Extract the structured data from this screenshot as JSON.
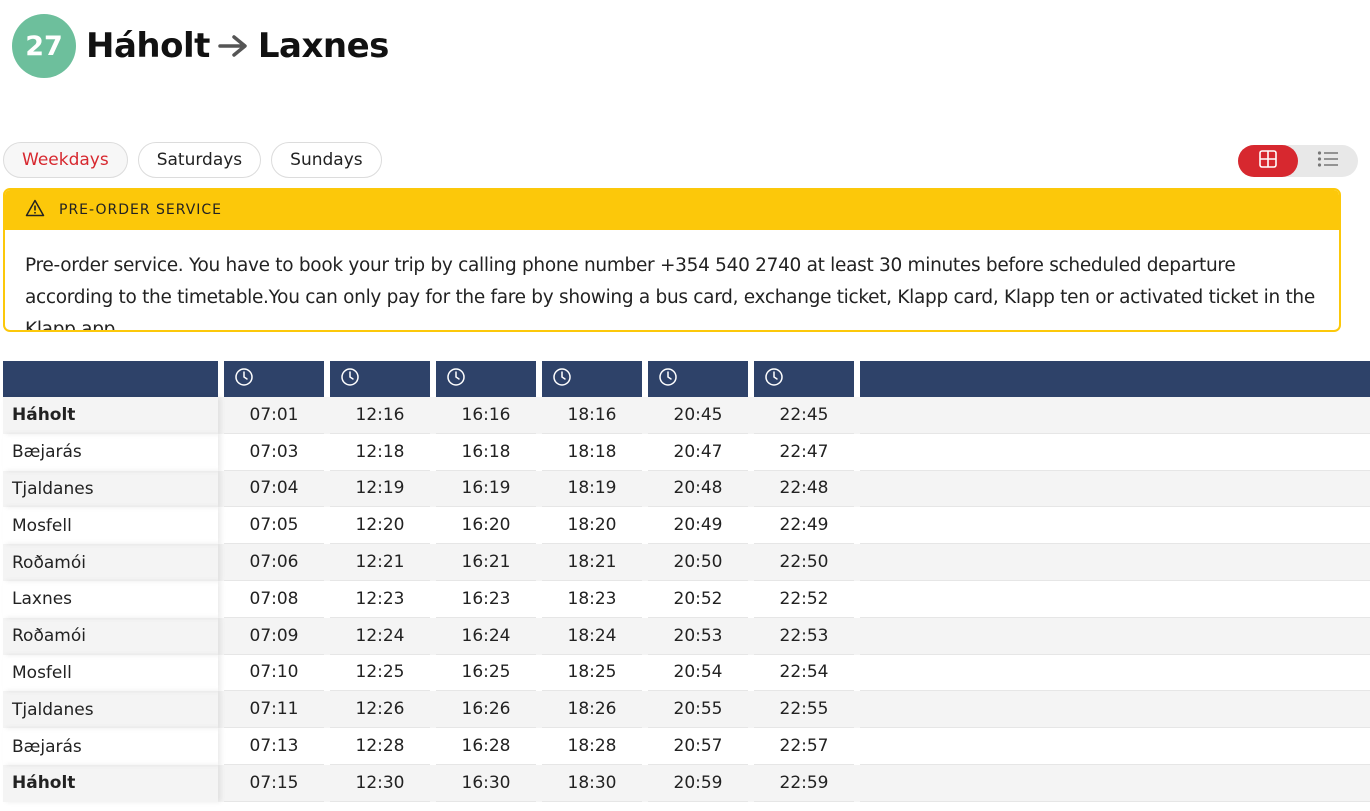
{
  "route": {
    "number": "27",
    "from": "Háholt",
    "to": "Laxnes"
  },
  "tabs": [
    "Weekdays",
    "Saturdays",
    "Sundays"
  ],
  "active_tab": "Weekdays",
  "view_toggle": {
    "active": "grid",
    "icons": [
      "grid-icon",
      "list-icon"
    ]
  },
  "notice": {
    "title": "PRE-ORDER SERVICE",
    "body": "Pre-order service. You have to book your trip by calling phone number +354 540 2740 at least 30 minutes before scheduled departure according to the timetable.You can only pay for the fare by showing a bus card, exchange ticket, Klapp card, Klapp ten or activated ticket in the Klapp app."
  },
  "timetable": {
    "rows": [
      {
        "stop": "Háholt",
        "bold": true,
        "times": [
          "07:01",
          "12:16",
          "16:16",
          "18:16",
          "20:45",
          "22:45"
        ]
      },
      {
        "stop": "Bæjarás",
        "bold": false,
        "times": [
          "07:03",
          "12:18",
          "16:18",
          "18:18",
          "20:47",
          "22:47"
        ]
      },
      {
        "stop": "Tjaldanes",
        "bold": false,
        "times": [
          "07:04",
          "12:19",
          "16:19",
          "18:19",
          "20:48",
          "22:48"
        ]
      },
      {
        "stop": "Mosfell",
        "bold": false,
        "times": [
          "07:05",
          "12:20",
          "16:20",
          "18:20",
          "20:49",
          "22:49"
        ]
      },
      {
        "stop": "Roðamói",
        "bold": false,
        "times": [
          "07:06",
          "12:21",
          "16:21",
          "18:21",
          "20:50",
          "22:50"
        ]
      },
      {
        "stop": "Laxnes",
        "bold": false,
        "times": [
          "07:08",
          "12:23",
          "16:23",
          "18:23",
          "20:52",
          "22:52"
        ]
      },
      {
        "stop": "Roðamói",
        "bold": false,
        "times": [
          "07:09",
          "12:24",
          "16:24",
          "18:24",
          "20:53",
          "22:53"
        ]
      },
      {
        "stop": "Mosfell",
        "bold": false,
        "times": [
          "07:10",
          "12:25",
          "16:25",
          "18:25",
          "20:54",
          "22:54"
        ]
      },
      {
        "stop": "Tjaldanes",
        "bold": false,
        "times": [
          "07:11",
          "12:26",
          "16:26",
          "18:26",
          "20:55",
          "22:55"
        ]
      },
      {
        "stop": "Bæjarás",
        "bold": false,
        "times": [
          "07:13",
          "12:28",
          "16:28",
          "18:28",
          "20:57",
          "22:57"
        ]
      },
      {
        "stop": "Háholt",
        "bold": true,
        "times": [
          "07:15",
          "12:30",
          "16:30",
          "18:30",
          "20:59",
          "22:59"
        ]
      }
    ]
  },
  "colors": {
    "route_badge": "#6dbf9c",
    "accent_red": "#d7282f",
    "notice_yellow": "#fcc80a",
    "table_header": "#2e4269"
  }
}
